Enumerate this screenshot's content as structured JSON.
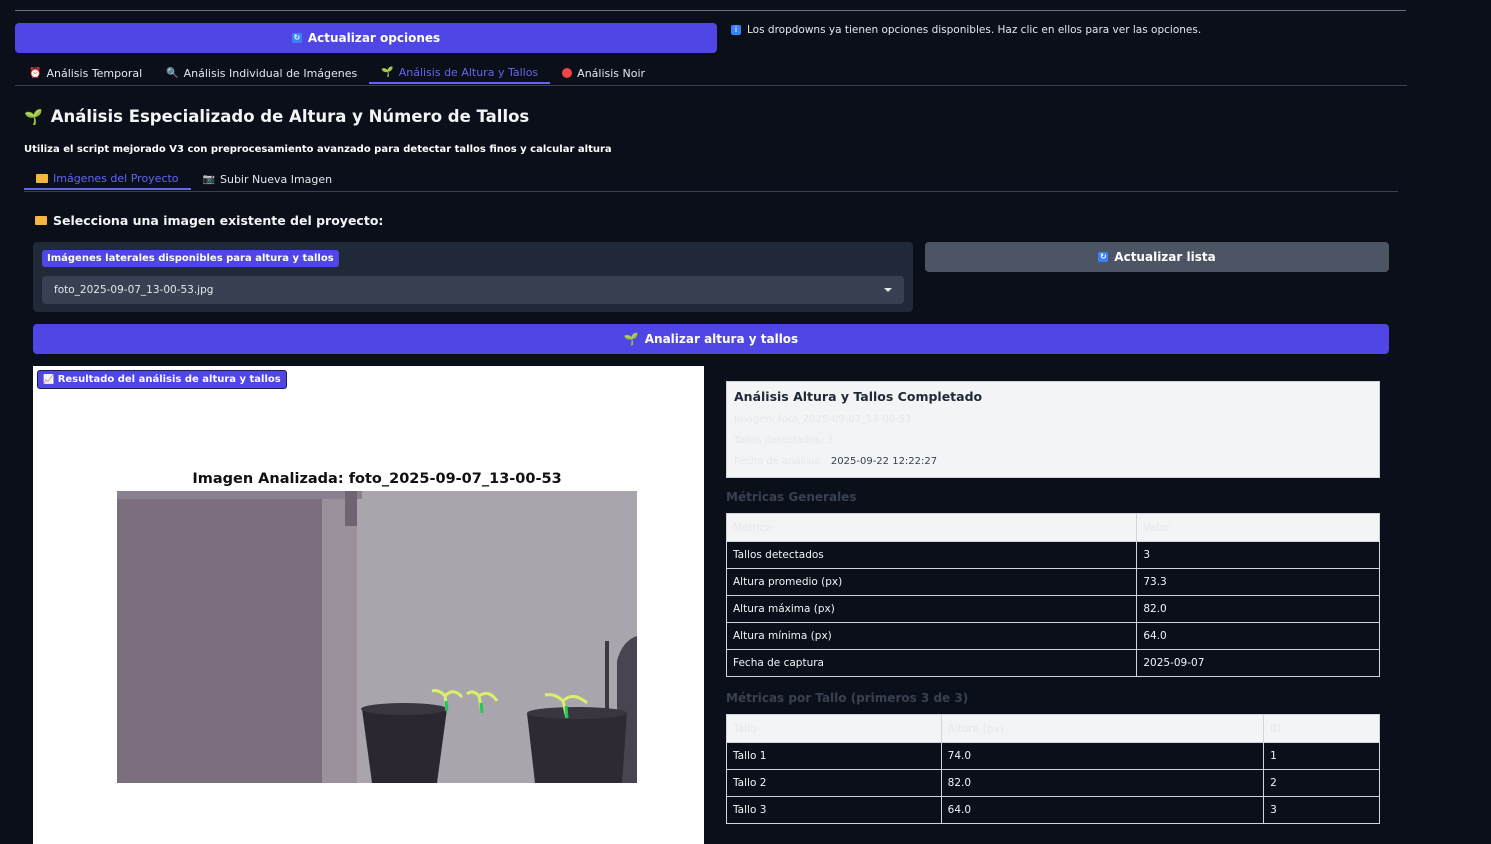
{
  "top": {
    "update_options_button": "Actualizar opciones",
    "info_note": "Los dropdowns ya tienen opciones disponibles. Haz clic en ellos para ver las opciones."
  },
  "main_tabs": [
    {
      "label": "Análisis Temporal",
      "icon": "alarm-clock-icon"
    },
    {
      "label": "Análisis Individual de Imágenes",
      "icon": "magnifier-icon"
    },
    {
      "label": "Análisis de Altura y Tallos",
      "icon": "seedling-icon",
      "active": true
    },
    {
      "label": "Análisis Noir",
      "icon": "red-circle-icon"
    }
  ],
  "section": {
    "title": "Análisis Especializado de Altura y Número de Tallos",
    "subtitle": "Utiliza el script mejorado V3 con preprocesamiento avanzado para detectar tallos finos y calcular altura"
  },
  "sub_tabs": [
    {
      "label": "Imágenes del Proyecto",
      "icon": "folder-icon",
      "active": true
    },
    {
      "label": "Subir Nueva Imagen",
      "icon": "camera-icon"
    }
  ],
  "select_section": {
    "heading": "Selecciona una imagen existente del proyecto:",
    "label": "Imágenes laterales disponibles para altura y tallos",
    "value": "foto_2025-09-07_13-00-53.jpg",
    "refresh_button": "Actualizar lista"
  },
  "analyze_button": "Analizar altura y tallos",
  "image_result": {
    "label": "Resultado del análisis de altura y tallos",
    "plot_title": "Imagen Analizada: foto_2025-09-07_13-00-53"
  },
  "result_card": {
    "title": "Análisis Altura y Tallos Completado",
    "line1": "Imagen: foto_2025-09-07_13-00-53",
    "line2": "Tallos detectados: 3",
    "line3_label": "Fecha de análisis:",
    "line3_value": "2025-09-22 12:22:27"
  },
  "general_metrics": {
    "heading": "Métricas Generales",
    "headers": [
      "Métrica",
      "Valor"
    ],
    "rows": [
      [
        "Tallos detectados",
        "3"
      ],
      [
        "Altura promedio (px)",
        "73.3"
      ],
      [
        "Altura máxima (px)",
        "82.0"
      ],
      [
        "Altura mínima (px)",
        "64.0"
      ],
      [
        "Fecha de captura",
        "2025-09-07"
      ]
    ]
  },
  "stem_metrics": {
    "heading": "Métricas por Tallo (primeros 3 de 3)",
    "headers": [
      "Tallo",
      "Altura (px)",
      "ID"
    ],
    "rows": [
      [
        "Tallo 1",
        "74.0",
        "1"
      ],
      [
        "Tallo 2",
        "82.0",
        "2"
      ],
      [
        "Tallo 3",
        "64.0",
        "3"
      ]
    ]
  }
}
